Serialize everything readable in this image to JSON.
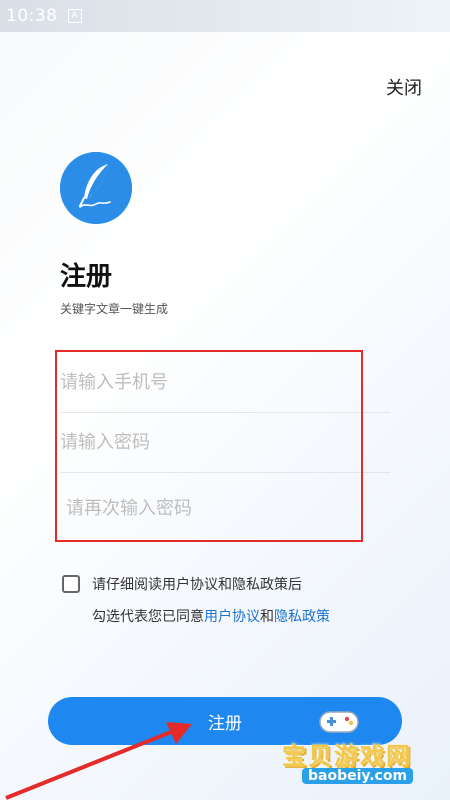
{
  "status_bar": {
    "time": "10:38",
    "notification_glyph": "A"
  },
  "header": {
    "close_label": "关闭"
  },
  "app": {
    "logo_icon": "feather-pen-icon",
    "brand_color": "#2b8de8"
  },
  "page": {
    "title": "注册",
    "subtitle": "关键字文章一键生成"
  },
  "form": {
    "phone_placeholder": "请输入手机号",
    "password_placeholder": "请输入密码",
    "confirm_password_placeholder": "请再次输入密码"
  },
  "agreement": {
    "checked": false,
    "line1": "请仔细阅读用户协议和隐私政策后",
    "line2_prefix": "勾选代表您已同意",
    "user_agreement_link": "用户协议",
    "conjunction": "和",
    "privacy_policy_link": "隐私政策"
  },
  "actions": {
    "register_label": "注册",
    "primary_color": "#1e88f0"
  },
  "watermark": {
    "title": "宝贝游戏网",
    "url": "baobeiy.com"
  },
  "annotation": {
    "highlight_color": "#e52a2a"
  }
}
